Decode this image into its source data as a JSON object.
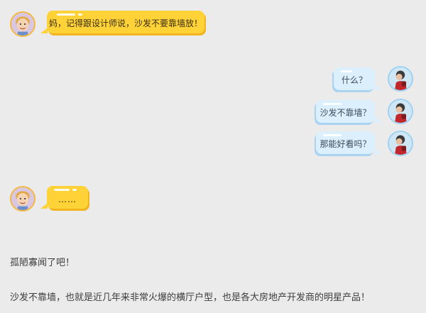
{
  "conversation": {
    "messages": [
      {
        "speaker": "kid",
        "text": "妈，记得跟设计师说，沙发不要靠墙放！"
      },
      {
        "speaker": "adult",
        "text": "什么？"
      },
      {
        "speaker": "adult",
        "text": "沙发不靠墙？"
      },
      {
        "speaker": "adult",
        "text": "那能好看吗？"
      },
      {
        "speaker": "kid",
        "text": "……"
      }
    ]
  },
  "article": {
    "paragraph_1": "孤陋寡闻了吧！",
    "paragraph_2": "沙发不靠墙，也就是近几年来非常火爆的横厅户型，也是各大房地产开发商的明星产品！"
  },
  "colors": {
    "background": "#ebebeb",
    "kid_bubble": "#ffd338",
    "adult_bubble": "#dceffc"
  }
}
